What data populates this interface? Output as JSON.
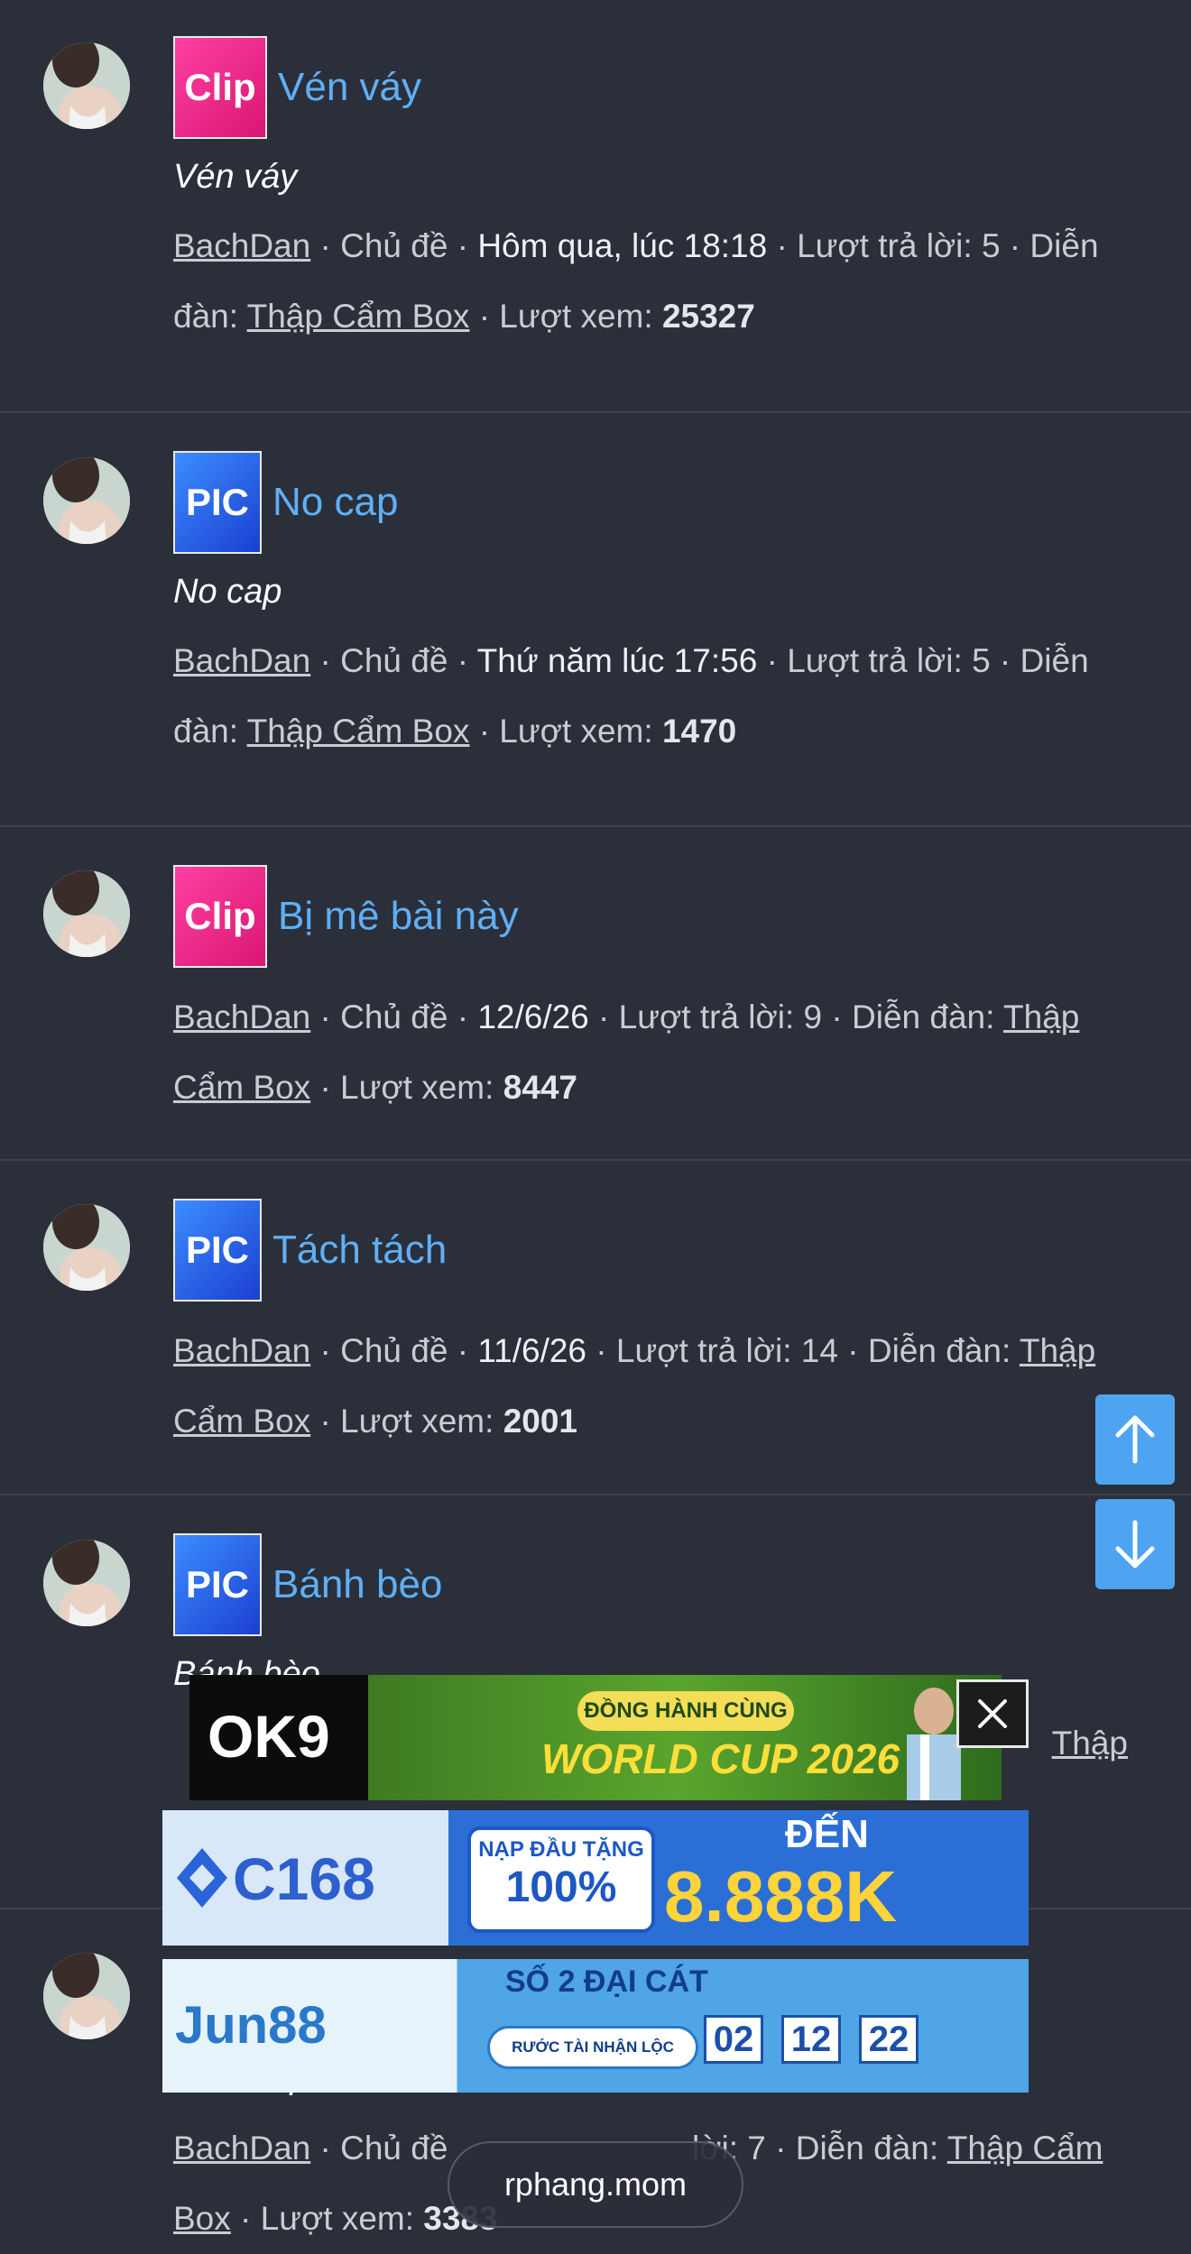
{
  "threads": [
    {
      "prefix": "Clip",
      "title": "Vén váy",
      "snippet": "Vén váy",
      "author": "BachDan",
      "sep1": " · ",
      "kind": "Chủ đề",
      "date": "Hôm qua, lúc 18:18",
      "replies_label": "Lượt trả lời: 5",
      "forum_label": "Diễn đàn: ",
      "forum": "Thập Cẩm Box",
      "views_label": "Lượt xem: ",
      "views": "25327"
    },
    {
      "prefix": "PIC",
      "title": "No cap",
      "snippet": "No cap",
      "author": "BachDan",
      "kind": "Chủ đề",
      "date": "Thứ năm lúc 17:56",
      "replies_label": "Lượt trả lời: 5",
      "forum_label": "Diễn đàn: ",
      "forum": "Thập Cẩm Box",
      "views_label": "Lượt xem: ",
      "views": "1470"
    },
    {
      "prefix": "Clip",
      "title": "Bị mê bài này",
      "author": "BachDan",
      "kind": "Chủ đề",
      "date": "12/6/26",
      "replies_label": "Lượt trả lời: 9",
      "forum_label": "Diễn đàn: ",
      "forum": "Thập Cẩm Box",
      "views_label": "Lượt xem: ",
      "views": "8447"
    },
    {
      "prefix": "PIC",
      "title": "Tách tách",
      "author": "BachDan",
      "kind": "Chủ đề",
      "date": "11/6/26",
      "replies_label": "Lượt trả lời: 14",
      "forum_label": "Diễn đàn: ",
      "forum": "Thập Cẩm Box",
      "views_label": "Lượt xem: ",
      "views": "2001"
    },
    {
      "prefix": "PIC",
      "title": "Bánh bèo",
      "snippet": "Bánh bèo",
      "forum_fragment": "Thập"
    },
    {
      "snippet": "Chủ nhật ơ nha",
      "author": "BachDan",
      "kind": "Chủ đề",
      "replies_fragment": "lời: 7",
      "forum_label": "Diễn đàn: ",
      "forum": "Thập Cẩm Box",
      "views_label": "Lượt xem: ",
      "views": "3383"
    }
  ],
  "ads": {
    "ok9": {
      "brand": "OK9",
      "tag1": "ĐỒNG HÀNH CÙNG",
      "tag2": "WORLD CUP 2026"
    },
    "c168": {
      "brand": "C168",
      "tag1": "NẠP ĐẦU TẶNG",
      "tag2": "100%",
      "tag3": "ĐẾN",
      "tag4": "8.888K"
    },
    "jun88": {
      "brand": "Jun88",
      "tag1": "SỐ 2 ĐẠI CÁT",
      "tag2": "RƯỚC TÀI NHẬN LỘC",
      "d1": "02",
      "d2": "12",
      "d3": "22"
    }
  },
  "domain": "rphang.mom",
  "colors": {
    "background": "#2b2f3a",
    "link": "#5fb0f5",
    "clip": "#e8278a",
    "pic": "#2f6ef0",
    "scroll_button": "#4ea4f1"
  }
}
